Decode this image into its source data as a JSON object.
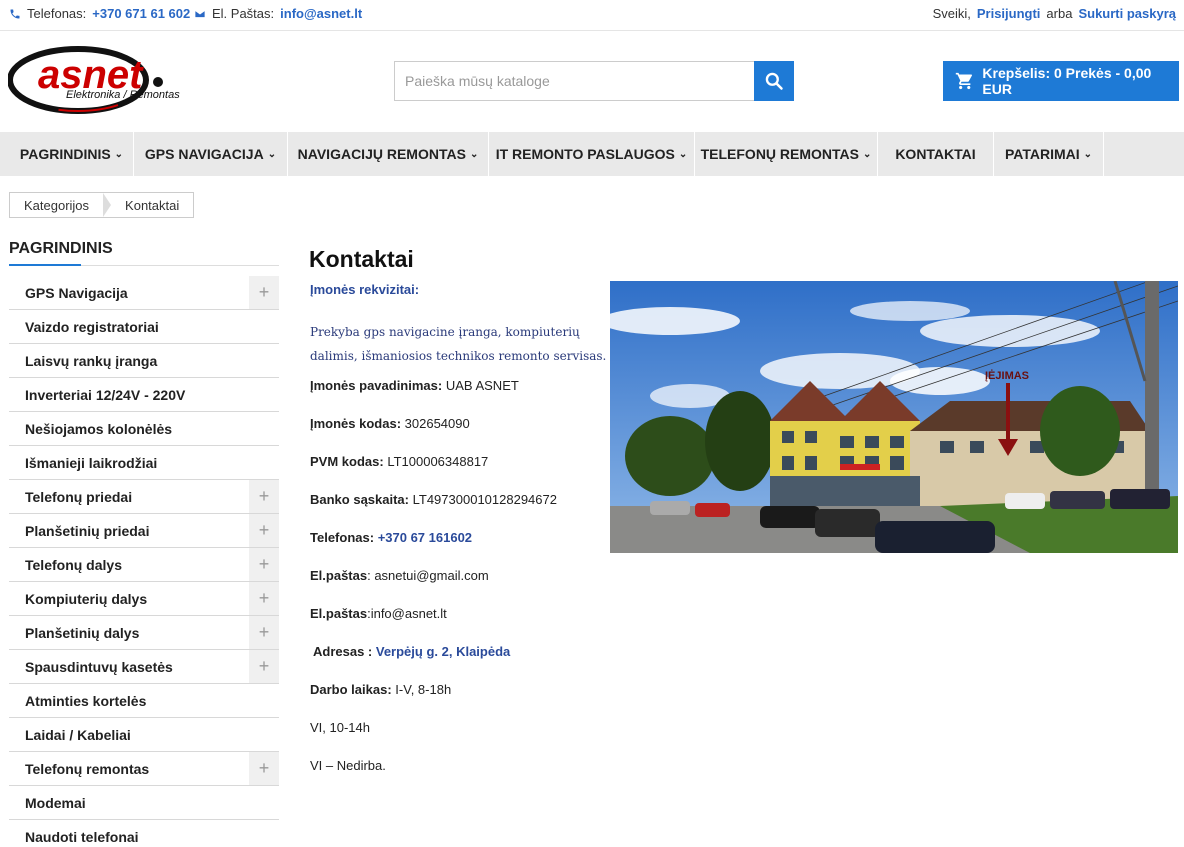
{
  "topbar": {
    "phone_label": "Telefonas:",
    "phone": "+370 671 61 602",
    "email_label": "El. Paštas:",
    "email": "info@asnet.lt",
    "greeting": "Sveiki,",
    "login": "Prisijungti",
    "or": "arba",
    "register": "Sukurti paskyrą"
  },
  "logo": {
    "brand": "asnet",
    "tagline": "Elektronika / Remontas"
  },
  "search": {
    "placeholder": "Paieška mūsų kataloge"
  },
  "cart": {
    "label": "Krepšelis: 0 Prekės - 0,00 EUR"
  },
  "nav": {
    "items": [
      {
        "label": "Pagrindinis",
        "chevron": true
      },
      {
        "label": "GPS navigacija",
        "chevron": true
      },
      {
        "label": "Navigacijų remontas",
        "chevron": true
      },
      {
        "label": "IT remonto paslaugos",
        "chevron": true
      },
      {
        "label": "Telefonų remontas",
        "chevron": true
      },
      {
        "label": "Kontaktai",
        "chevron": false
      },
      {
        "label": "Patarimai",
        "chevron": true
      }
    ]
  },
  "breadcrumb": {
    "items": [
      "Kategorijos",
      "Kontaktai"
    ]
  },
  "sidebar": {
    "title": "PAGRINDINIS",
    "items": [
      {
        "label": "GPS Navigacija",
        "expandable": true
      },
      {
        "label": "Vaizdo registratoriai",
        "expandable": false
      },
      {
        "label": "Laisvų rankų įranga",
        "expandable": false
      },
      {
        "label": "Inverteriai 12/24V - 220V",
        "expandable": false
      },
      {
        "label": "Nešiojamos kolonėlės",
        "expandable": false
      },
      {
        "label": "Išmanieji laikrodžiai",
        "expandable": false
      },
      {
        "label": "Telefonų priedai",
        "expandable": true
      },
      {
        "label": "Planšetinių priedai",
        "expandable": true
      },
      {
        "label": "Telefonų dalys",
        "expandable": true
      },
      {
        "label": "Kompiuterių dalys",
        "expandable": true
      },
      {
        "label": "Planšetinių dalys",
        "expandable": true
      },
      {
        "label": "Spausdintuvų kasetės",
        "expandable": true
      },
      {
        "label": "Atminties kortelės",
        "expandable": false
      },
      {
        "label": "Laidai / Kabeliai",
        "expandable": false
      },
      {
        "label": "Telefonų remontas",
        "expandable": true
      },
      {
        "label": "Modemai",
        "expandable": false
      },
      {
        "label": "Naudoti telefonai",
        "expandable": false
      }
    ]
  },
  "main": {
    "title": "Kontaktai",
    "requisites_heading": "Įmonės rekvizitai:",
    "description": "Prekyba gps navigacine įranga, kompiuterių dalimis, išmaniosios technikos remonto servisas.",
    "company_name_label": "Įmonės pavadinimas:",
    "company_name": "UAB ASNET",
    "company_code_label": "Įmonės kodas:",
    "company_code": "302654090",
    "vat_label": "PVM kodas:",
    "vat": "LT100006348817",
    "bank_label": "Banko sąskaita:",
    "bank": "LT497300010128294672",
    "phone_label": "Telefonas:",
    "phone": "+370 67 161602",
    "email1_label": "El.paštas",
    "email1": ": asnetui@gmail.com",
    "email2_label": "El.paštas",
    "email2": ":info@asnet.lt",
    "address_label": "Adresas :",
    "address": "Verpėjų g. 2, Klaipėda",
    "hours_label": "Darbo laikas:",
    "hours1": "I-V, 8-18h",
    "hours2": "VI, 10-14h",
    "hours3": "VI – Nedirba.",
    "photo_sign": "ĮĖJIMAS"
  },
  "colors": {
    "accent": "#1e7ad6",
    "link": "#2a68c5",
    "nav_bg": "#e9e9e9"
  }
}
